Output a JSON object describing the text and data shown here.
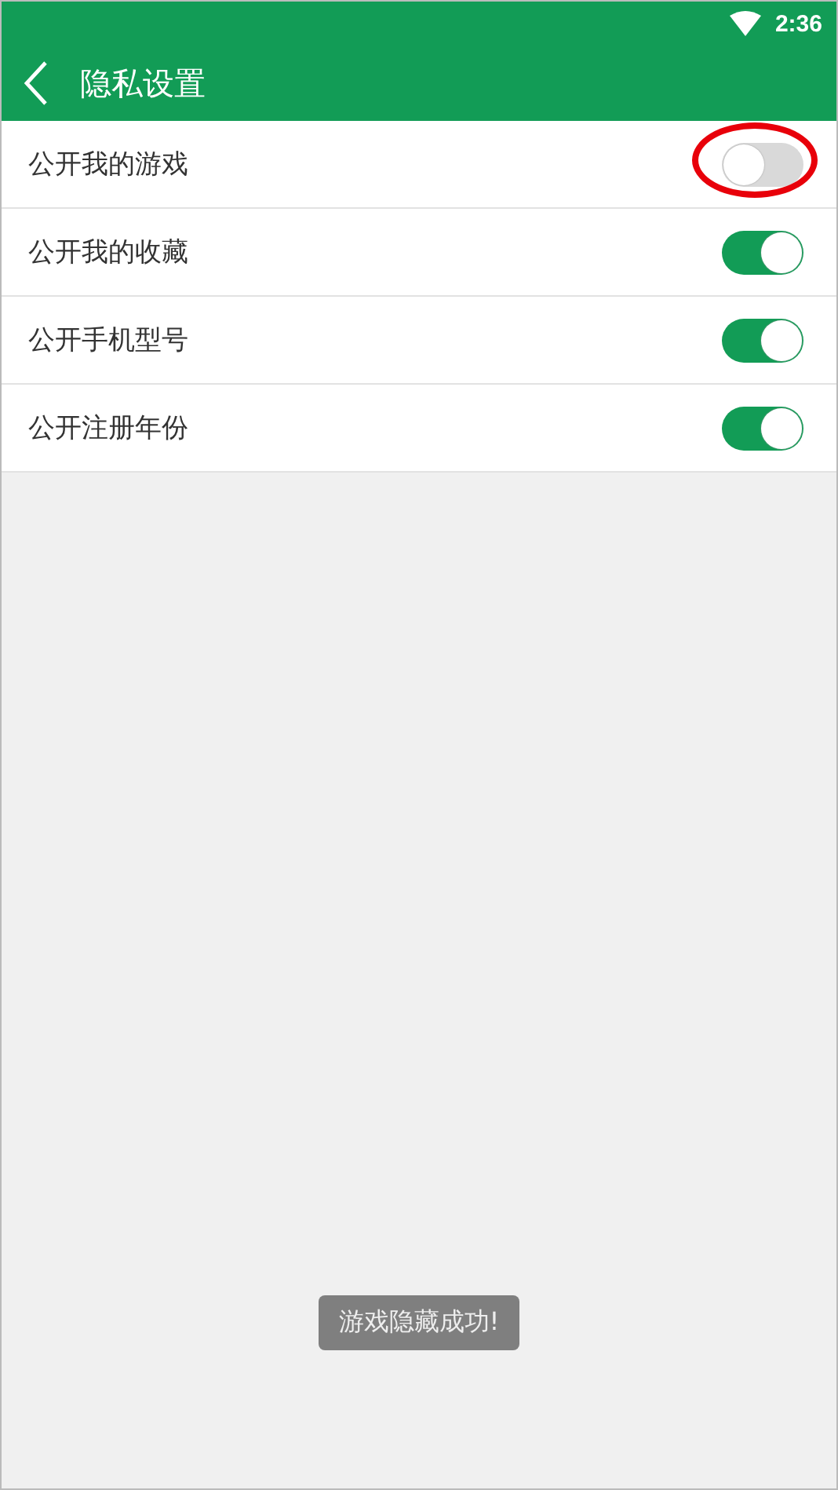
{
  "status_bar": {
    "time": "2:36"
  },
  "app_bar": {
    "title": "隐私设置"
  },
  "settings": [
    {
      "label": "公开我的游戏",
      "on": false,
      "highlighted": true
    },
    {
      "label": "公开我的收藏",
      "on": true,
      "highlighted": false
    },
    {
      "label": "公开手机型号",
      "on": true,
      "highlighted": false
    },
    {
      "label": "公开注册年份",
      "on": true,
      "highlighted": false
    }
  ],
  "toast": {
    "text": "游戏隐藏成功!"
  }
}
